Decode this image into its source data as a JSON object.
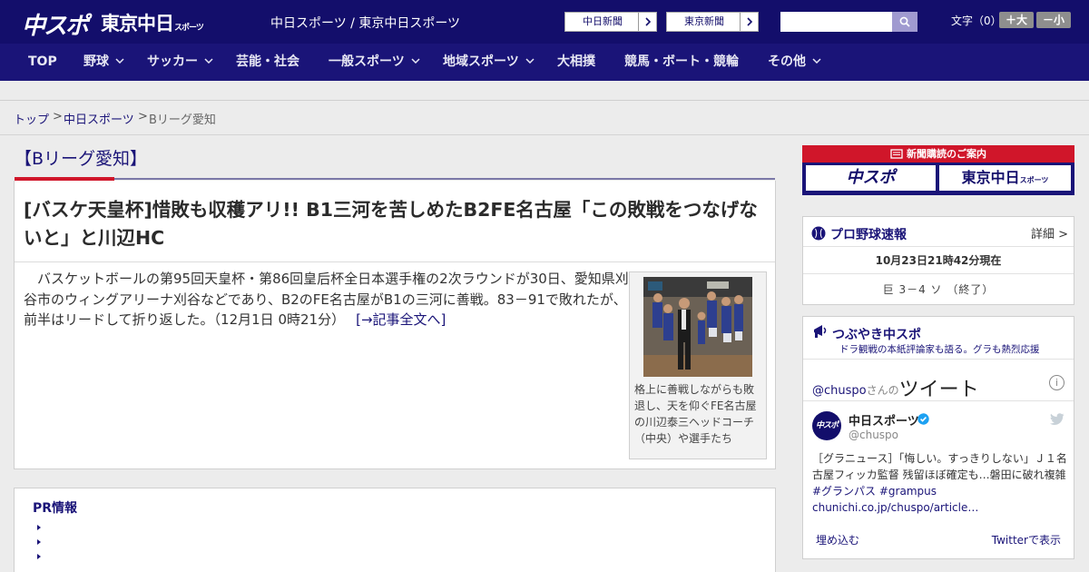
{
  "header": {
    "logo": "中スポ",
    "logo_tokyo": "東京中日",
    "logo_tokyo_suffix": "スポーツ",
    "site_links": "中日スポーツ / 東京中日スポーツ",
    "paper_buttons": [
      "中日新聞",
      "東京新聞"
    ],
    "search_placeholder": "",
    "font_size_label": "文字（0）",
    "font_larger": "＋大",
    "font_smaller": "－小"
  },
  "nav": {
    "items": [
      {
        "label": "TOP",
        "dropdown": false
      },
      {
        "label": "野球",
        "dropdown": true
      },
      {
        "label": "サッカー",
        "dropdown": true
      },
      {
        "label": "芸能・社会",
        "dropdown": false
      },
      {
        "label": "一般スポーツ",
        "dropdown": true
      },
      {
        "label": "地域スポーツ",
        "dropdown": true
      },
      {
        "label": "大相撲",
        "dropdown": false
      },
      {
        "label": "競馬・ボート・競輪",
        "dropdown": false
      },
      {
        "label": "その他",
        "dropdown": true
      }
    ]
  },
  "breadcrumb": {
    "top": "トップ",
    "sep": ">",
    "section": "中日スポーツ",
    "current": "Bリーグ愛知"
  },
  "article": {
    "section_title": "【Bリーグ愛知】",
    "headline": "[バスケ天皇杯]惜敗も収穫アリ!! B1三河を苦しめたB2FE名古屋「この敗戦をつなげないと」と川辺HC",
    "lead": "バスケットボールの第95回天皇杯・第86回皇后杯全日本選手権の2次ラウンドが30日、愛知県刈谷市のウィングアリーナ刈谷などであり、B2のFE名古屋がB1の三河に善戦。83－91で敗れたが、前半はリードして折り返した。（12月1日 0時21分）",
    "more_link": "[→記事全文へ]",
    "photo_caption": "格上に善戦しながらも敗退し、天を仰ぐFE名古屋の川辺泰三ヘッドコーチ（中央）や選手たち"
  },
  "pr": {
    "title": "PR情報",
    "items": [
      "",
      "",
      ""
    ]
  },
  "sidebar": {
    "subscribe_label": "新聞購読のご案内",
    "subscribe_logos": [
      "中スポ",
      "東京中日"
    ],
    "subscribe_tokyo_suffix": "スポーツ",
    "baseball": {
      "title": "プロ野球速報",
      "detail": "詳細 >",
      "updated": "10月23日21時42分現在",
      "score": "巨 3－4 ソ （終了）"
    },
    "tweets": {
      "title": "つぶやき中スポ",
      "subtitle": "ドラ観戦の本紙評論家も語る。グラも熱烈応援",
      "handle_link": "@chuspo",
      "handle_suffix": "さんの",
      "heading": "ツイート",
      "info": "i",
      "account_name": "中日スポーツ",
      "account_handle": "@chuspo",
      "avatar_text": "中スポ",
      "tweet_text": "［グラニュース］「悔しい。すっきりしない」Ｊ１名古屋フィッカ監督 残留ほぼ確定も…磐田に破れ複雑",
      "tweet_tags": "#グランパス #grampus",
      "tweet_link": "chunichi.co.jp/chuspo/article…",
      "embed": "埋め込む",
      "view_on_twitter": "Twitterで表示"
    }
  },
  "colors": {
    "brand_navy": "#130e6b",
    "nav_bg": "#1a1478",
    "accent_red": "#d0162a",
    "twitter_blue": "#1da1f2"
  }
}
